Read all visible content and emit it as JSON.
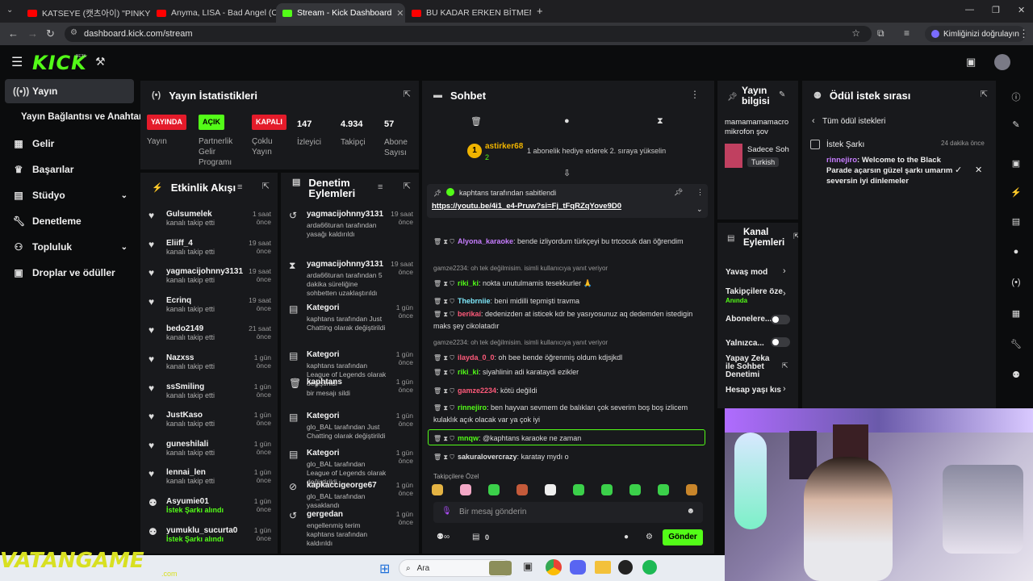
{
  "browser": {
    "tabs": [
      {
        "title": "KATSEYE (캣츠아이) \"PINKY UP\"",
        "color": "#ff0000"
      },
      {
        "title": "Anyma, LISA - Bad Angel (Offic",
        "color": "#ff0000"
      },
      {
        "title": "Stream - Kick Dashboard",
        "color": "#53fc18"
      },
      {
        "title": "BU KADAR ERKEN BİTMEMELİYDİ",
        "color": "#ff0000"
      }
    ],
    "url": "dashboard.kick.com/stream",
    "identity_button": "Kimliğinizi doğrulayın"
  },
  "header": {
    "logo": "KICK",
    "beta": "BETA"
  },
  "sidebar": {
    "items": [
      {
        "label": "Yayın",
        "icon": "broadcast-icon"
      },
      {
        "label": "Yayın Bağlantısı ve Anahtarı",
        "icon": ""
      },
      {
        "label": "Gelir",
        "icon": "chart-icon"
      },
      {
        "label": "Başarılar",
        "icon": "trophy-icon"
      },
      {
        "label": "Stüdyo",
        "icon": "grid-icon"
      },
      {
        "label": "Denetleme",
        "icon": "wrench-icon"
      },
      {
        "label": "Topluluk",
        "icon": "users-icon"
      },
      {
        "label": "Droplar ve ödüller",
        "icon": "gift-icon"
      }
    ]
  },
  "stats": {
    "title": "Yayın İstatistikleri",
    "items": [
      {
        "badge": "YAYINDA",
        "label": "Yayın"
      },
      {
        "badge": "AÇIK",
        "label": "Partnerlik Gelir Programı"
      },
      {
        "badge": "KAPALI",
        "label": "Çoklu Yayın"
      },
      {
        "value": "147",
        "label": "İzleyici"
      },
      {
        "value": "4.934",
        "label": "Takipçi"
      },
      {
        "value": "57",
        "label": "Abone Sayısı"
      }
    ]
  },
  "activity": {
    "title": "Etkinlik Akışı",
    "items": [
      {
        "name": "Gulsumelek",
        "sub": "kanalı takip etti",
        "time": "1 saat önce"
      },
      {
        "name": "Eliiff_4",
        "sub": "kanalı takip etti",
        "time": "19 saat önce"
      },
      {
        "name": "yagmacijohnny3131",
        "sub": "kanalı takip etti",
        "time": "19 saat önce"
      },
      {
        "name": "Ecrinq",
        "sub": "kanalı takip etti",
        "time": "19 saat önce"
      },
      {
        "name": "bedo2149",
        "sub": "kanalı takip etti",
        "time": "21 saat önce"
      },
      {
        "name": "Nazxss",
        "sub": "kanalı takip etti",
        "time": "1 gün önce"
      },
      {
        "name": "ssSmiling",
        "sub": "kanalı takip etti",
        "time": "1 gün önce"
      },
      {
        "name": "JustKaso",
        "sub": "kanalı takip etti",
        "time": "1 gün önce"
      },
      {
        "name": "guneshilali",
        "sub": "kanalı takip etti",
        "time": "1 gün önce"
      },
      {
        "name": "lennai_len",
        "sub": "kanalı takip etti",
        "time": "1 gün önce"
      },
      {
        "name": "Asyumie01",
        "sub": "İstek Şarkı alındı",
        "time": "1 gün önce"
      },
      {
        "name": "yumuklu_sucurta0",
        "sub": "İstek Şarkı alındı",
        "time": "1 gün önce"
      }
    ]
  },
  "moderation": {
    "title": "Denetim Eylemleri",
    "items": [
      {
        "name": "yagmacijohnny3131",
        "desc": "arda66turan tarafından yasağı kaldırıldı",
        "time": "19 saat önce"
      },
      {
        "name": "yagmacijohnny3131",
        "desc": "arda66turan tarafından 5 dakika süreliğine sohbetten uzaklaştırıldı",
        "time": "19 saat önce"
      },
      {
        "name": "Kategori",
        "desc": "kaphtans tarafından Just Chatting olarak değiştirildi",
        "time": "1 gün önce"
      },
      {
        "name": "Kategori",
        "desc": "kaphtans tarafından League of Legends olarak değiştirildi",
        "time": "1 gün önce"
      },
      {
        "name": "kaphtans",
        "desc": "bir mesajı sildi",
        "time": "1 gün önce"
      },
      {
        "name": "Kategori",
        "desc": "glo_BAL tarafından Just Chatting olarak değiştirildi",
        "time": "1 gün önce"
      },
      {
        "name": "Kategori",
        "desc": "glo_BAL tarafından League of Legends olarak değiştirildi",
        "time": "1 gün önce"
      },
      {
        "name": "kapkaccigeorge67",
        "desc": "glo_BAL tarafından yasaklandı",
        "time": "1 gün önce"
      },
      {
        "name": "gergedan",
        "desc": "engellenmiş terim kaphtans tarafından kaldırıldı",
        "time": "1 gün önce"
      }
    ]
  },
  "chat": {
    "title": "Sohbet",
    "top_user": "astirker68",
    "top_count": "2",
    "top_text": "1 abonelik hediye ederek 2. sıraya yükselin",
    "pinned_by": "kaphtans tarafından sabitlendi",
    "pinned_link": "https://youtu.be/4i1_e4-Pruw?si=Fj_tFqRZqYove9D0",
    "messages": [
      {
        "user": "Alyona_karaoke",
        "color": "#c77dff",
        "text": "bende izliyordum türkçeyi bu trtcocuk dan öğrendim"
      },
      {
        "user": "riki_ki",
        "color": "#53fc18",
        "text": "nokta unutulmamis tesekkurler 🙏",
        "reply": "gamze2234: oh tek değilmisim. isimli kullanıcıya yanıt veriyor"
      },
      {
        "user": "Thebrniie",
        "color": "#7ee8fa",
        "text": "beni midilli tepmişti travma"
      },
      {
        "user": "berikaí",
        "color": "#ff5a7a",
        "text": "dedenizden at isticek kdr be yasıyosunuz aq dedemden istedigin maks şey cikolatadır"
      },
      {
        "user": "ilayda_0_0",
        "color": "#ff5a7a",
        "text": "oh bee bende öğrenmiş oldum kdjsjkdl",
        "reply": "gamze2234: oh tek değilmisim. isimli kullanıcıya yanıt veriyor"
      },
      {
        "user": "riki_ki",
        "color": "#53fc18",
        "text": "siyahlinin adi karataydi ezikler"
      },
      {
        "user": "gamze2234",
        "color": "#ff5a7a",
        "text": "kötü değildi"
      },
      {
        "user": "rinnejiro",
        "color": "#53fc18",
        "text": "ben hayvan sevmem de balıkları çok severim boş boş izlicem kulaklık açık olacak var ya çok iyi"
      },
      {
        "user": "mnqw",
        "color": "#53fc18",
        "text": "@kaphtans karaoke ne zaman"
      },
      {
        "user": "sakuralovercrazy",
        "color": "#e0e0e0",
        "text": "karatay mydı o"
      }
    ],
    "emote_label": "Takipçilere Özel",
    "input_placeholder": "Bir mesaj gönderin",
    "points": "0",
    "send_label": "Gönder"
  },
  "stream_info": {
    "title": "Yayın bilgisi",
    "stream_title": "mamamamamacro mikrofon şov",
    "category": "Sadece Soh",
    "tag": "Turkish"
  },
  "channel_actions": {
    "title": "Kanal Eylemleri",
    "items": [
      {
        "label": "Yavaş mod"
      },
      {
        "label": "Takipçilere öze",
        "sub": "Anında"
      },
      {
        "label": "Abonelere..."
      },
      {
        "label": "Yalnızca..."
      },
      {
        "label": "Yapay Zeka ile Sohbet Denetimi"
      },
      {
        "label": "Hesap yaşı kıs"
      }
    ]
  },
  "rewards": {
    "title": "Ödül istek sırası",
    "back_label": "Tüm ödül istekleri",
    "item_title": "İstek Şarkı",
    "item_time": "24 dakika önce",
    "item_user": "rinnejiro",
    "item_text": "Welcome to the Black Parade açarsın güzel şarkı umarım seversin iyi dinlemeler"
  },
  "taskbar": {
    "search": "Ara",
    "overlay_brand": "VATANGAME",
    "overlay_sub": ".com"
  },
  "colors": {
    "accent": "#53fc18",
    "panel": "#18191c",
    "bg": "#0b0c0d"
  }
}
